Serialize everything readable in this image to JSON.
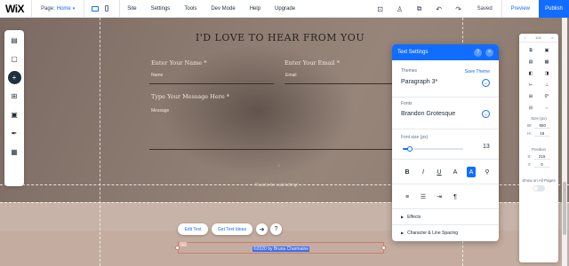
{
  "topbar": {
    "logo": "WiX",
    "page_label": "Page:",
    "page_value": "Home",
    "menu": [
      "Site",
      "Settings",
      "Tools",
      "Dev Mode",
      "Help",
      "Upgrade"
    ],
    "saved": "Saved",
    "preview": "Preview",
    "publish": "Publish"
  },
  "site": {
    "heading": "I'D LOVE TO HEAR FROM YOU",
    "name_label": "Enter Your Name *",
    "name_placeholder": "Name",
    "email_label": "Enter Your Email *",
    "email_placeholder": "Email",
    "message_label": "Type Your Message Here *",
    "message_placeholder": "Message",
    "thanks": "Thanks for submitting!",
    "footer_text": "©2020 by Bruna Charmaine"
  },
  "floating_toolbar": {
    "edit_text": "Edit Text",
    "get_text_ideas": "Get Text Ideas",
    "help": "?"
  },
  "text_settings": {
    "title": "Text Settings",
    "themes_label": "Themes",
    "save_theme": "Save Theme",
    "theme_value": "Paragraph 3*",
    "fonts_label": "Fonts",
    "font_value": "Brandon Grotesque",
    "size_label": "Font size (px)",
    "size_value": "13",
    "size_fraction": 0.12,
    "format_buttons": [
      "B",
      "I",
      "U",
      "A",
      "A"
    ],
    "effects": "Effects",
    "char_spacing": "Character & Line Spacing"
  },
  "inspector": {
    "zoom": "101",
    "size_label": "Size (px)",
    "w_label": "W:",
    "w_value": "550",
    "h_label": "H:",
    "h_value": "18",
    "position_label": "Position",
    "x_label": "X:",
    "x_value": "215",
    "y_label": "Y:",
    "y_value": "0",
    "angle": "0°",
    "show_on_all_pages": "Show on All Pages"
  },
  "colors": {
    "accent": "#116dff",
    "hero": "#8c7b70",
    "footer": "#c7b3a7"
  }
}
